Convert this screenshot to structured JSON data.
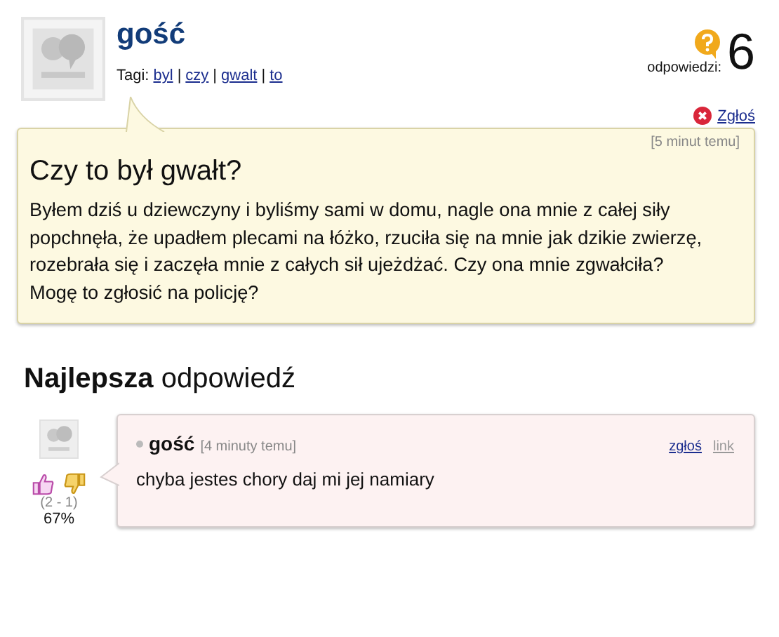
{
  "question": {
    "author": "gość",
    "tags_label": "Tagi:",
    "tag_separator": "|",
    "tags": [
      "byl",
      "czy",
      "gwalt",
      "to"
    ],
    "answers_label": "odpowiedzi:",
    "answers_count": "6",
    "report": "Zgłoś",
    "time": "[5 minut temu]",
    "title": "Czy to był gwałt?",
    "body": "Byłem dziś u dziewczyny i byliśmy sami w domu, nagle ona mnie z całej siły popchnęła, że upadłem plecami na łóżko, rzuciła się na mnie jak dzikie zwierzę, rozebrała się i zaczęła mnie z całych sił ujeżdżać. Czy ona mnie zgwałciła? Mogę to zgłosić na policję?"
  },
  "best_answer": {
    "heading": "**Najlepsza** odpowiedź",
    "votes": "(2 - 1)",
    "percent": "67%",
    "author": "gość",
    "time": "[4 minuty temu]",
    "report": "zgłoś",
    "link": "link",
    "text": "chyba jestes chory daj mi jej namiary"
  }
}
